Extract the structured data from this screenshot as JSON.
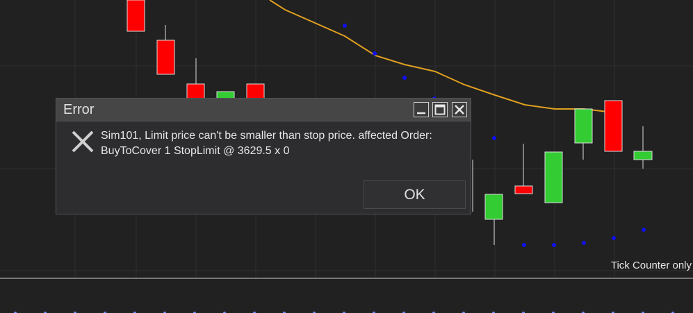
{
  "colors": {
    "background": "#212121",
    "grid": "#2e2e2e",
    "up_candle": "#33cc33",
    "down_candle": "#ff0000",
    "wick": "#dddddd",
    "moving_average": "#e0a020",
    "psar_dots": "#1010ee"
  },
  "chart": {
    "tick_counter": "Tick Counter only"
  },
  "dialog": {
    "title": "Error",
    "minimize_icon": "minimize-icon",
    "maximize_icon": "maximize-icon",
    "close_icon": "close-icon",
    "error_icon": "x-icon",
    "message": "Sim101, Limit price can't be smaller than stop price. affected Order: BuyToCover 1 StopLimit @ 3629.5 x 0",
    "ok_label": "OK"
  }
}
